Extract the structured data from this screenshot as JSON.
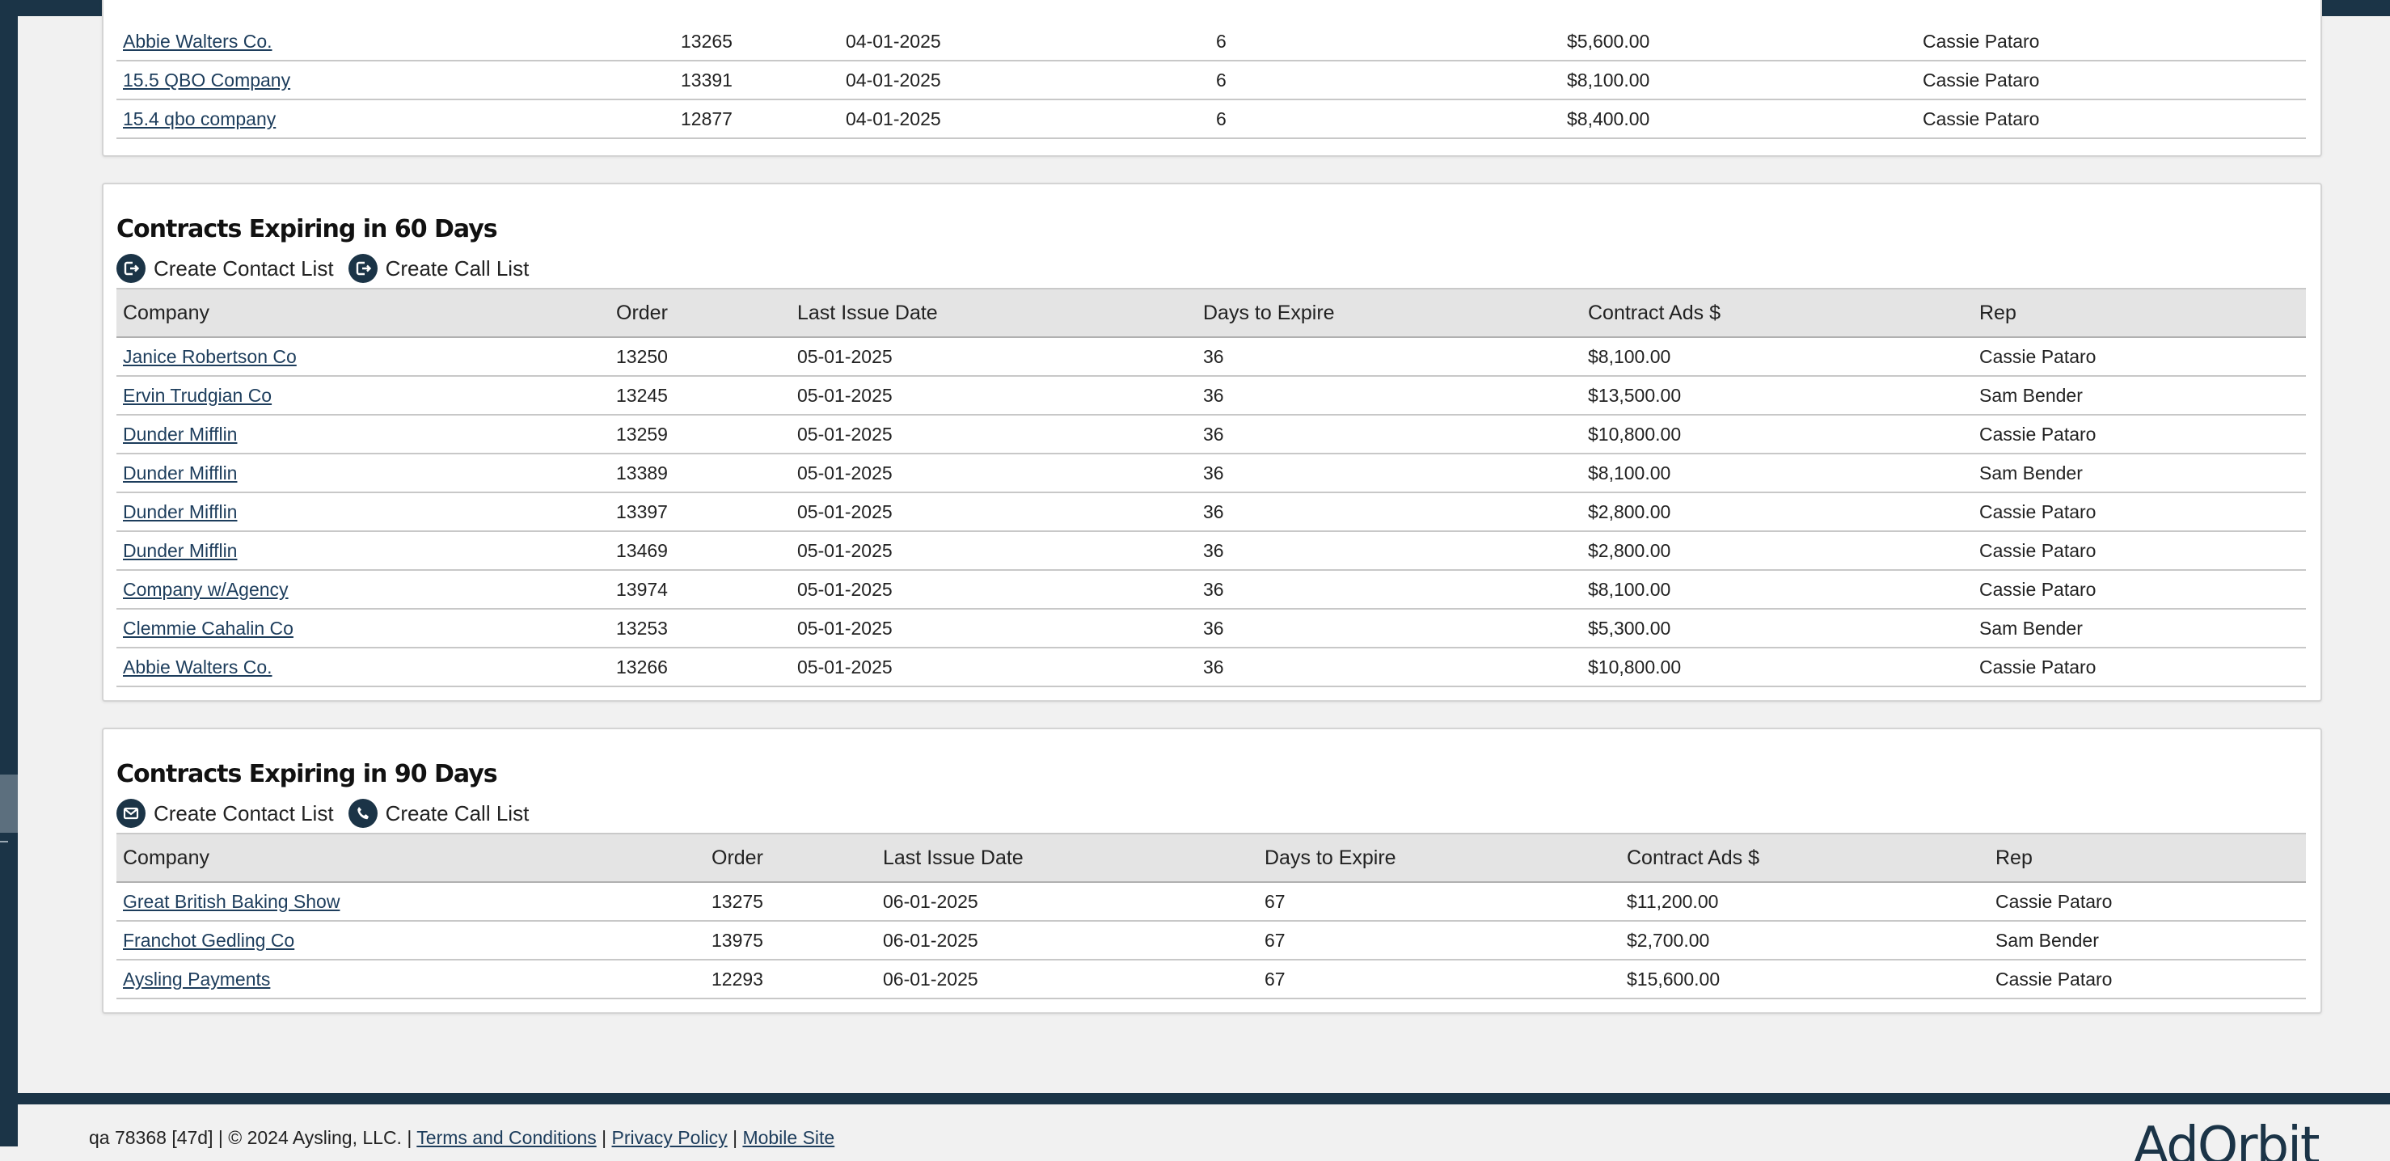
{
  "footer": {
    "version_text": "qa 78368 [47d] | © 2024 Aysling, LLC. |",
    "terms_label": "Terms and Conditions",
    "sep1": "|",
    "privacy_label": "Privacy Policy",
    "sep2": "|",
    "mobile_label": "Mobile Site",
    "brand": "AdOrbit"
  },
  "colors": {
    "nav": "#1b3447",
    "link": "#1d3d5c",
    "header_bg": "#e4e4e4"
  },
  "icons": {
    "contact": "export-icon",
    "call": "export-icon",
    "contact_90": "envelope-icon",
    "call_90": "phone-icon"
  },
  "sections": [
    {
      "title": "",
      "columns": [],
      "rows": [
        {
          "company": "Abbie Walters Co.",
          "order": "13265",
          "last_issue": "04-01-2025",
          "days": "6",
          "ads": "$5,600.00",
          "rep": "Cassie Pataro"
        },
        {
          "company": "15.5 QBO Company",
          "order": "13391",
          "last_issue": "04-01-2025",
          "days": "6",
          "ads": "$8,100.00",
          "rep": "Cassie Pataro"
        },
        {
          "company": "15.4 qbo company",
          "order": "12877",
          "last_issue": "04-01-2025",
          "days": "6",
          "ads": "$8,400.00",
          "rep": "Cassie Pataro"
        }
      ]
    },
    {
      "title": "Contracts Expiring in 60 Days",
      "contact_label": "Create Contact List",
      "call_label": "Create Call List",
      "columns": [
        "Company",
        "Order",
        "Last Issue Date",
        "Days to Expire",
        "Contract Ads $",
        "Rep"
      ],
      "rows": [
        {
          "company": "Janice Robertson Co",
          "order": "13250",
          "last_issue": "05-01-2025",
          "days": "36",
          "ads": "$8,100.00",
          "rep": "Cassie Pataro"
        },
        {
          "company": "Ervin Trudgian Co",
          "order": "13245",
          "last_issue": "05-01-2025",
          "days": "36",
          "ads": "$13,500.00",
          "rep": "Sam Bender"
        },
        {
          "company": "Dunder Mifflin",
          "order": "13259",
          "last_issue": "05-01-2025",
          "days": "36",
          "ads": "$10,800.00",
          "rep": "Cassie Pataro"
        },
        {
          "company": "Dunder Mifflin",
          "order": "13389",
          "last_issue": "05-01-2025",
          "days": "36",
          "ads": "$8,100.00",
          "rep": "Sam Bender"
        },
        {
          "company": "Dunder Mifflin",
          "order": "13397",
          "last_issue": "05-01-2025",
          "days": "36",
          "ads": "$2,800.00",
          "rep": "Cassie Pataro"
        },
        {
          "company": "Dunder Mifflin",
          "order": "13469",
          "last_issue": "05-01-2025",
          "days": "36",
          "ads": "$2,800.00",
          "rep": "Cassie Pataro"
        },
        {
          "company": "Company w/Agency",
          "order": "13974",
          "last_issue": "05-01-2025",
          "days": "36",
          "ads": "$8,100.00",
          "rep": "Cassie Pataro"
        },
        {
          "company": "Clemmie Cahalin Co",
          "order": "13253",
          "last_issue": "05-01-2025",
          "days": "36",
          "ads": "$5,300.00",
          "rep": "Sam Bender"
        },
        {
          "company": "Abbie Walters Co.",
          "order": "13266",
          "last_issue": "05-01-2025",
          "days": "36",
          "ads": "$10,800.00",
          "rep": "Cassie Pataro"
        }
      ]
    },
    {
      "title": "Contracts Expiring in 90 Days",
      "contact_label": "Create Contact List",
      "call_label": "Create Call List",
      "columns": [
        "Company",
        "Order",
        "Last Issue Date",
        "Days to Expire",
        "Contract Ads $",
        "Rep"
      ],
      "rows": [
        {
          "company": "Great British Baking Show",
          "order": "13275",
          "last_issue": "06-01-2025",
          "days": "67",
          "ads": "$11,200.00",
          "rep": "Cassie Pataro"
        },
        {
          "company": "Franchot Gedling Co",
          "order": "13975",
          "last_issue": "06-01-2025",
          "days": "67",
          "ads": "$2,700.00",
          "rep": "Sam Bender"
        },
        {
          "company": "Aysling Payments",
          "order": "12293",
          "last_issue": "06-01-2025",
          "days": "67",
          "ads": "$15,600.00",
          "rep": "Cassie Pataro"
        }
      ]
    }
  ]
}
